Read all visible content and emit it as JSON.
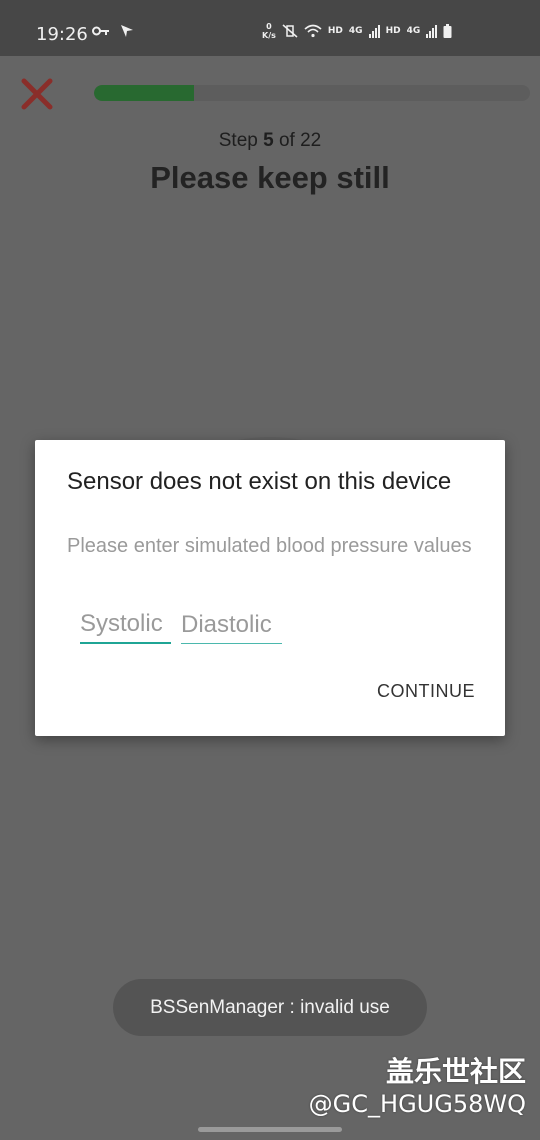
{
  "status_bar": {
    "time": "19:26",
    "net_speed_value": "0",
    "net_speed_unit": "K/s",
    "hd1": "HD",
    "net1": "4G",
    "hd2": "HD",
    "net2": "4G",
    "icons": [
      "key-icon",
      "location-arrow-icon",
      "mute-vibrate-icon",
      "wifi-icon",
      "signal-icon",
      "battery-icon"
    ]
  },
  "header": {
    "progress_fraction": 0.23,
    "step_prefix": "Step",
    "step_current": "5",
    "step_of": "of 22",
    "title": "Please keep still"
  },
  "dialog": {
    "title": "Sensor does not exist on this device",
    "message": "Please enter simulated blood pressure values",
    "systolic_placeholder": "Systolic",
    "systolic_value": "",
    "diastolic_placeholder": "Diastolic",
    "diastolic_value": "",
    "continue_label": "CONTINUE"
  },
  "toast": {
    "text": "BSSenManager : invalid use"
  },
  "watermark": {
    "line1": "盖乐世社区",
    "line2": "@GC_HGUG58WQ"
  },
  "colors": {
    "accent_teal": "#1fa595",
    "progress_green": "#286930",
    "close_red": "#8a2e2a"
  }
}
